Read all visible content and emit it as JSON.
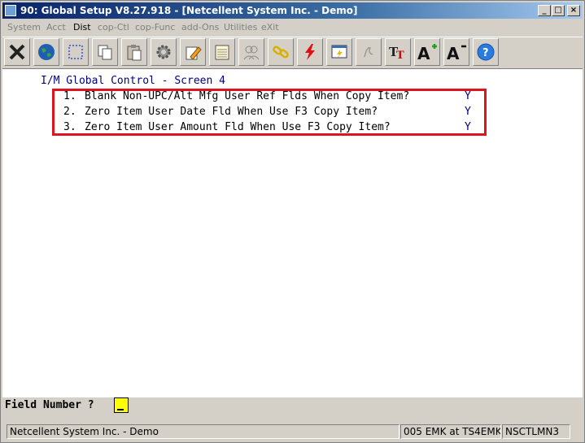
{
  "window": {
    "title": "90: Global Setup V8.27.918 - [Netcellent System Inc. - Demo]",
    "minimize_glyph": "_",
    "maximize_glyph": "□",
    "close_glyph": "×"
  },
  "menu": {
    "items": [
      {
        "label": "System",
        "enabled": false
      },
      {
        "label": "Acct",
        "enabled": false
      },
      {
        "label": "Dist",
        "enabled": true
      },
      {
        "label": "cop-Ctl",
        "enabled": false
      },
      {
        "label": "cop-Func",
        "enabled": false
      },
      {
        "label": "add-Ons",
        "enabled": false
      },
      {
        "label": "Utilities",
        "enabled": false
      },
      {
        "label": "eXit",
        "enabled": false
      }
    ]
  },
  "toolbar": {
    "buttons": [
      {
        "icon": "close-x-icon"
      },
      {
        "icon": "globe-icon"
      },
      {
        "icon": "select-box-icon"
      },
      {
        "icon": "copy-icon"
      },
      {
        "icon": "paste-icon"
      },
      {
        "icon": "gear-icon"
      },
      {
        "icon": "edit-pencil-icon"
      },
      {
        "icon": "notepad-icon"
      },
      {
        "icon": "users-icon"
      },
      {
        "icon": "link-icon"
      },
      {
        "icon": "lightning-icon"
      },
      {
        "icon": "screen-action-icon"
      },
      {
        "icon": "script-icon"
      },
      {
        "icon": "font-tt-icon"
      },
      {
        "icon": "font-increase-icon"
      },
      {
        "icon": "font-decrease-icon"
      },
      {
        "icon": "help-icon"
      }
    ]
  },
  "screen": {
    "heading": "I/M Global Control - Screen 4",
    "options": [
      {
        "number": "1.",
        "text": "Blank Non-UPC/Alt Mfg User Ref Flds When Copy Item?",
        "value": "Y"
      },
      {
        "number": "2.",
        "text": "Zero Item User Date Fld When Use F3 Copy Item?",
        "value": "Y"
      },
      {
        "number": "3.",
        "text": "Zero Item User Amount Fld When Use F3 Copy Item?",
        "value": "Y"
      }
    ]
  },
  "prompt": {
    "label": "Field Number ?"
  },
  "status": {
    "company": "Netcellent System Inc. - Demo",
    "session": "005 EMK at TS4EMK",
    "terminal": "NSCTLMN3"
  },
  "colors": {
    "highlight_border": "#e0141e",
    "heading_text": "#000080",
    "cursor_fill": "#ffff00"
  }
}
